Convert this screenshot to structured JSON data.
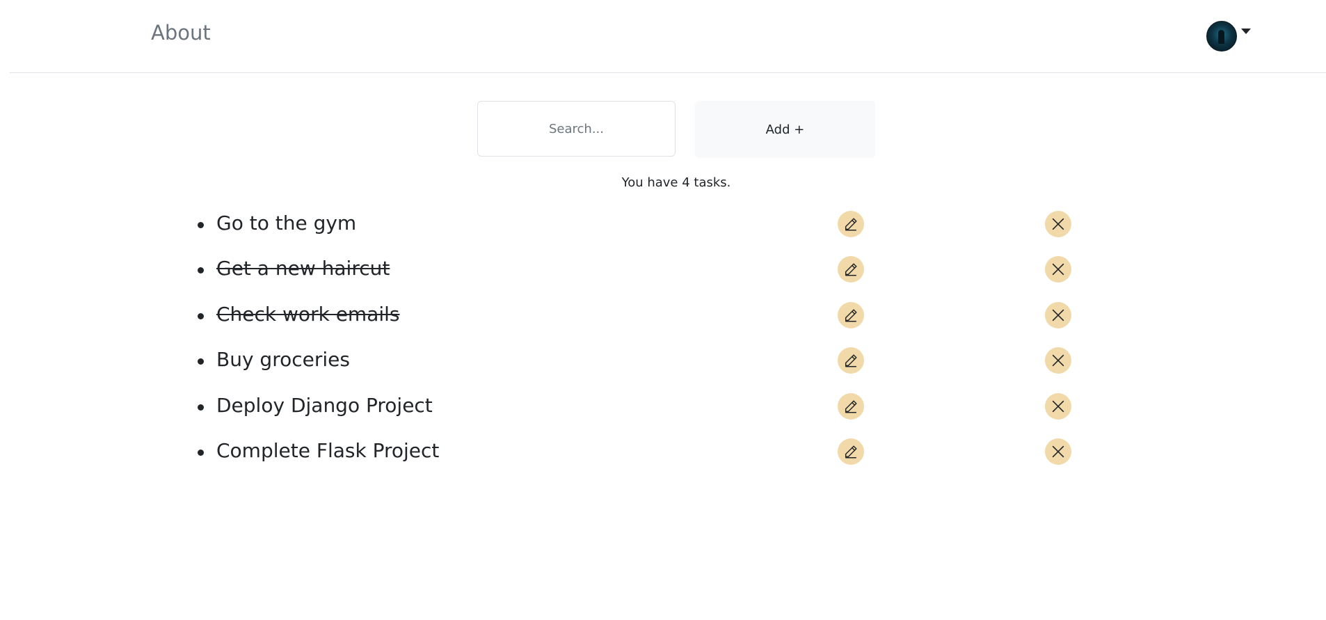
{
  "nav": {
    "about_label": "About",
    "avatar_icon": "user-avatar",
    "dropdown_icon": "caret-down-icon"
  },
  "toolbar": {
    "search_placeholder": "Search...",
    "add_label": "Add +"
  },
  "summary": {
    "task_count_text": "You have 4 tasks."
  },
  "tasks": [
    {
      "title": "Go to the gym",
      "completed": false
    },
    {
      "title": "Get a new haircut",
      "completed": true
    },
    {
      "title": "Check work emails",
      "completed": true
    },
    {
      "title": "Buy groceries",
      "completed": false
    },
    {
      "title": "Deploy Django Project",
      "completed": false
    },
    {
      "title": "Complete Flask Project",
      "completed": false
    }
  ],
  "icons": {
    "edit": "pencil-icon",
    "delete": "close-icon"
  },
  "colors": {
    "action_button_bg": "#f2d9a9",
    "text": "#212529",
    "muted": "#6c757d",
    "add_button_bg": "#f8f9fa",
    "border": "#dee2e6"
  }
}
